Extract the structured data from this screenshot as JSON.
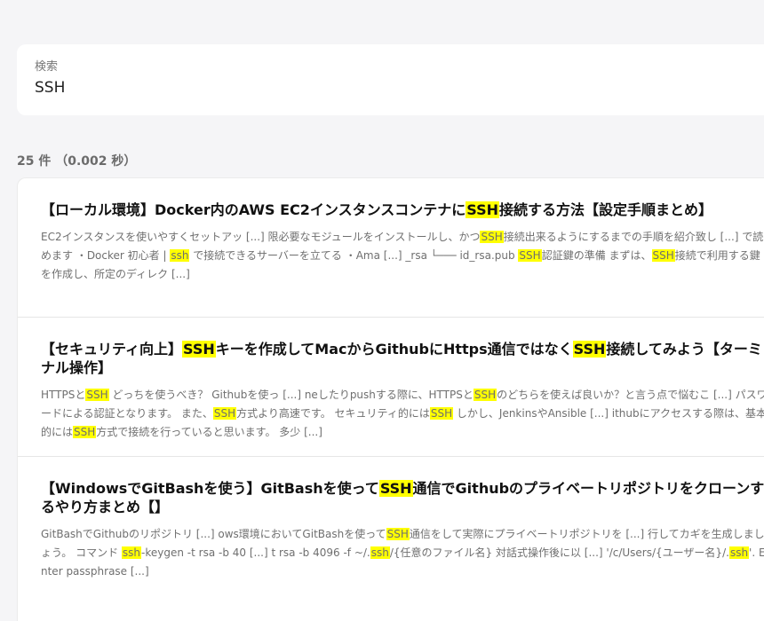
{
  "search": {
    "label": "検索",
    "value": "SSH"
  },
  "summary": {
    "count_text": "25 件",
    "time_text": "（0.002 秒）"
  },
  "highlight_color": "#ffff00",
  "results": [
    {
      "title": [
        "【ローカル環境】Docker内のAWS EC2インスタンスコンテナに",
        "SSH",
        "接続する方法【設定手順まとめ】"
      ],
      "snippet": [
        "EC2インスタンスを使いやすくセットアッ [...] 限必要なモジュールをインストールし、かつ",
        "SSH",
        "接続出来るようにするまでの手順を紹介致し [...] で読めます ・Docker 初心者 | ",
        "ssh",
        " で接続できるサーバーを立てる ・Ama [...] _rsa └─── id_rsa.pub ",
        "SSH",
        "認証鍵の準備 まずは、",
        "SSH",
        "接続で利用する鍵を作成し、所定のディレク [...]"
      ]
    },
    {
      "title": [
        "【セキュリティ向上】",
        "SSH",
        "キーを作成してMacからGithubにHttps通信ではなく",
        "SSH",
        "接続してみよう【ターミナル操作】"
      ],
      "snippet": [
        "HTTPSと",
        "SSH",
        " どっちを使うべき？ Githubを使っ [...] neしたりpushする際に、HTTPSと",
        "SSH",
        "のどちらを使えば良いか？と言う点で悩むこ [...] パスワードによる認証となります。 また、",
        "SSH",
        "方式より高速です。 セキュリティ的には",
        "SSH",
        " しかし、JenkinsやAnsible [...] ithubにアクセスする際は、基本的には",
        "SSH",
        "方式で接続を行っていると思います。 多少 [...]"
      ]
    },
    {
      "title": [
        "【WindowsでGitBashを使う】GitBashを使って",
        "SSH",
        "通信でGithubのプライベートリポジトリをクローンするやり方まとめ【】"
      ],
      "snippet": [
        "GitBashでGithubのリポジトリ [...] ows環境においてGitBashを使って",
        "SSH",
        "通信をして実際にプライベートリポジトリを [...] 行してカギを生成しましょう。 コマンド ",
        "ssh",
        "-keygen -t rsa -b 40 [...] t rsa -b 4096 -f ~/.",
        "ssh",
        "/{任意のファイル名} 対話式操作後に以 [...] '/c/Users/{ユーザー名}/.",
        "ssh",
        "'. Enter passphrase [...]"
      ]
    }
  ]
}
